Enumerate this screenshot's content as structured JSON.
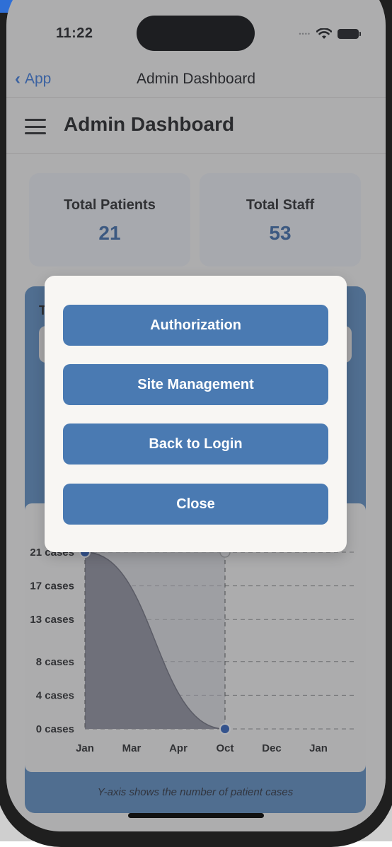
{
  "status_bar": {
    "time": "11:22",
    "signal_dots": "••••"
  },
  "nav": {
    "back_label": "App",
    "title": "Admin Dashboard"
  },
  "app_bar": {
    "title": "Admin Dashboard"
  },
  "stats": [
    {
      "label": "Total Patients",
      "value": "21"
    },
    {
      "label": "Total Staff",
      "value": "53"
    }
  ],
  "chart_card": {
    "heading_fragment": "T",
    "note": "Y-axis shows the number of patient cases"
  },
  "modal": {
    "buttons": [
      "Authorization",
      "Site Management",
      "Back to Login",
      "Close"
    ]
  },
  "colors": {
    "accent": "#4a7ab2",
    "card_blue": "#5d8bbd",
    "stat_value": "#3d6aa5",
    "link_blue": "#3b78d8"
  },
  "chart_data": {
    "type": "area",
    "categories": [
      "Jan",
      "Mar",
      "Apr",
      "Oct",
      "Dec",
      "Jan"
    ],
    "y_tick_labels": [
      "0 cases",
      "4 cases",
      "8 cases",
      "13 cases",
      "17 cases",
      "21 cases"
    ],
    "y_ticks": [
      0,
      4,
      8,
      13,
      17,
      21
    ],
    "ylim": [
      0,
      21
    ],
    "series": [
      {
        "points": [
          {
            "x": "Jan",
            "y": 21
          },
          {
            "x": "Oct",
            "y": 0
          }
        ]
      }
    ],
    "highlight_x": "Oct",
    "grid": "dashed-horizontal"
  }
}
